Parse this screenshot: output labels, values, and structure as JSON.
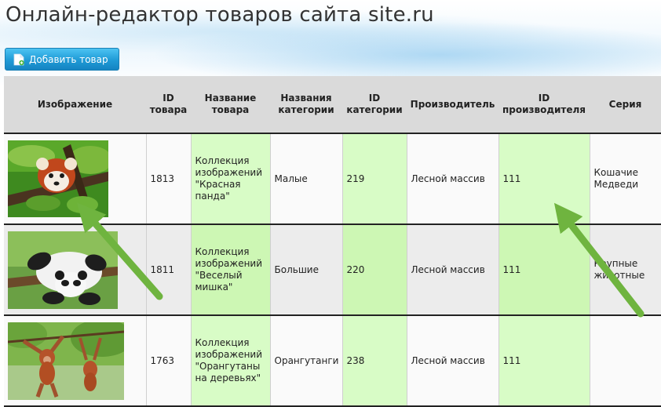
{
  "page": {
    "title": "Онлайн-редактор товаров сайта site.ru"
  },
  "toolbar": {
    "add_label": "Добавить товар",
    "add_icon": "add-document-icon"
  },
  "table": {
    "headers": [
      "Изображение",
      "ID товара",
      "Название товара",
      "Названия категории",
      "ID категории",
      "Производитель",
      "ID производителя",
      "Серия"
    ],
    "rows": [
      {
        "image": "red-panda-photo",
        "id": "1813",
        "name": "Коллекция изображений \"Красная панда\"",
        "category": "Малые",
        "category_id": "219",
        "manufacturer": "Лесной массив",
        "manufacturer_id": "111",
        "series": "Кошачие Медведи"
      },
      {
        "image": "panda-photo",
        "id": "1811",
        "name": "Коллекция изображений \"Веселый мишка\"",
        "category": "Большие",
        "category_id": "220",
        "manufacturer": "Лесной массив",
        "manufacturer_id": "111",
        "series": "Крупные животные"
      },
      {
        "image": "orangutan-photo",
        "id": "1763",
        "name": "Коллекция изображений \"Орангутаны на деревьях\"",
        "category": "Орангутанги",
        "category_id": "238",
        "manufacturer": "Лесной массив",
        "manufacturer_id": "111",
        "series": ""
      }
    ]
  },
  "colors": {
    "accent": "#1f9ad6",
    "highlight_green": "#d8fcc6",
    "arrow_green": "#6fb43f"
  }
}
